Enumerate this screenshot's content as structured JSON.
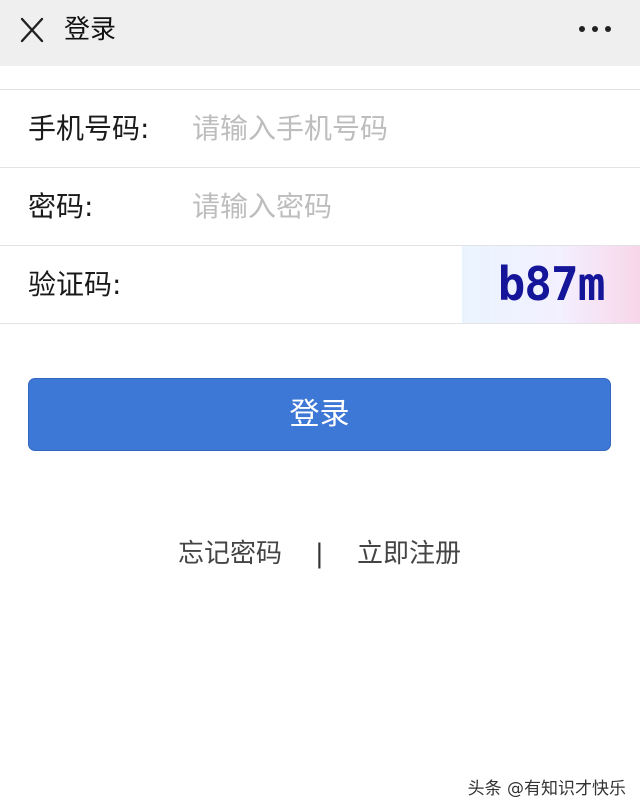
{
  "header": {
    "title": "登录",
    "close_icon": "close-icon",
    "more_icon": "more-horizontal-icon"
  },
  "form": {
    "phone": {
      "label": "手机号码:",
      "value": "",
      "placeholder": "请输入手机号码"
    },
    "password": {
      "label": "密码:",
      "value": "",
      "placeholder": "请输入密码"
    },
    "captcha": {
      "label": "验证码:",
      "value": "",
      "code": "b87m"
    }
  },
  "login_button": {
    "label": "登录",
    "color": "#3e78d6"
  },
  "links": {
    "forgot_password": "忘记密码",
    "separator": "|",
    "register": "立即注册"
  },
  "watermark": {
    "text": "头条 @有知识才快乐"
  }
}
